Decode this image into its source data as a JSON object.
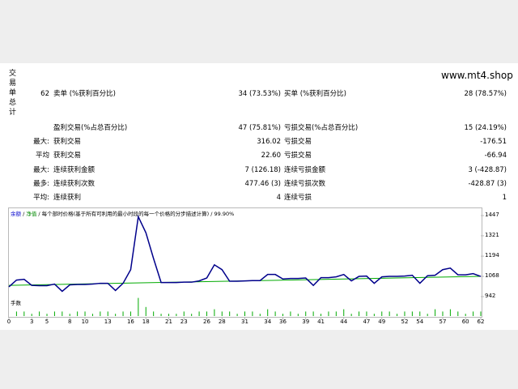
{
  "side_title": "交易单总计",
  "site": "www.mt4.shop",
  "stats": {
    "total_trades": "62",
    "short_label": "卖单 (%获利百分比)",
    "short_value": "34 (73.53%)",
    "long_label": "买单 (%获利百分比)",
    "long_value": "28 (78.57%)",
    "profit_trades_label": "盈利交易(%占总百分比)",
    "profit_trades_value": "47 (75.81%)",
    "loss_trades_label": "亏损交易(%占总百分比)",
    "loss_trades_value": "15 (24.19%)",
    "largest_label": "最大:",
    "largest_profit_label": "获利交易",
    "largest_profit_value": "316.02",
    "largest_loss_label": "亏损交易",
    "largest_loss_value": "-176.51",
    "average_label": "平均",
    "average_profit_label": "获利交易",
    "average_profit_value": "22.60",
    "average_loss_label": "亏损交易",
    "average_loss_value": "-66.94",
    "max_label": "最大:",
    "max_consec_wins_label": "连续获利金额",
    "max_consec_wins_value": "7 (126.18)",
    "max_consec_losses_label": "连续亏损金额",
    "max_consec_losses_value": "3 (-428.87)",
    "maximal_label": "最多:",
    "maximal_consec_profit_label": "连续获利次数",
    "maximal_consec_profit_value": "477.46 (3)",
    "maximal_consec_loss_label": "连续亏损次数",
    "maximal_consec_loss_value": "-428.87 (3)",
    "avg_label": "平均:",
    "avg_consec_wins_label": "连续获利",
    "avg_consec_wins_value": "4",
    "avg_consec_losses_label": "连续亏损",
    "avg_consec_losses_value": "1"
  },
  "chart": {
    "header_balance": "余额",
    "header_sep1": " / ",
    "header_equity": "净值",
    "header_rest": " / 每个部时价格(基于所有可利用的最小时段的每一个价格的分步描述计算) / 99.90%",
    "volume_label": "手数"
  },
  "chart_data": {
    "type": "line",
    "ylim": [
      942,
      1447
    ],
    "yticks": [
      "1447",
      "1321",
      "1194",
      "1068",
      "942"
    ],
    "xticks": [
      "0",
      "3",
      "5",
      "8",
      "10",
      "13",
      "16",
      "18",
      "21",
      "23",
      "26",
      "28",
      "31",
      "34",
      "36",
      "39",
      "41",
      "44",
      "47",
      "49",
      "52",
      "54",
      "57",
      "60",
      "62"
    ],
    "colors": {
      "balance": "#00008b",
      "equity": "#00aa00",
      "volume": "#00aa00",
      "axis": "#b9b9b9"
    },
    "series": [
      {
        "name": "余额",
        "x": [
          0,
          1,
          2,
          3,
          4,
          5,
          6,
          7,
          8,
          9,
          10,
          11,
          12,
          13,
          14,
          15,
          16,
          17,
          18,
          19,
          20,
          21,
          22,
          23,
          24,
          25,
          26,
          27,
          28,
          29,
          30,
          31,
          32,
          33,
          34,
          35,
          36,
          37,
          38,
          39,
          40,
          41,
          42,
          43,
          44,
          45,
          46,
          47,
          48,
          49,
          50,
          51,
          52,
          53,
          54,
          55,
          56,
          57,
          58,
          59,
          60,
          61,
          62
        ],
        "values": [
          1003,
          1045,
          1050,
          1012,
          1010,
          1010,
          1020,
          975,
          1015,
          1018,
          1018,
          1020,
          1025,
          1025,
          980,
          1025,
          1110,
          1440,
          1340,
          1180,
          1030,
          1030,
          1030,
          1032,
          1032,
          1040,
          1058,
          1140,
          1110,
          1038,
          1038,
          1040,
          1042,
          1042,
          1080,
          1080,
          1052,
          1055,
          1055,
          1058,
          1012,
          1060,
          1060,
          1065,
          1080,
          1040,
          1068,
          1070,
          1025,
          1065,
          1068,
          1068,
          1070,
          1075,
          1025,
          1072,
          1075,
          1110,
          1120,
          1078,
          1078,
          1085,
          1068
        ]
      }
    ],
    "equity_from": {
      "x": 0,
      "y": 1012
    },
    "equity_to": {
      "x": 62,
      "y": 1068
    },
    "volume": [
      0,
      2,
      2,
      1,
      2,
      1,
      2,
      2,
      1,
      2,
      2,
      1,
      2,
      2,
      1,
      2,
      2,
      8,
      4,
      2,
      1,
      1,
      1,
      2,
      1,
      2,
      2,
      3,
      2,
      2,
      1,
      2,
      2,
      1,
      3,
      2,
      1,
      2,
      1,
      2,
      2,
      1,
      2,
      2,
      3,
      1,
      2,
      2,
      1,
      2,
      2,
      1,
      2,
      2,
      2,
      1,
      3,
      2,
      3,
      2,
      1,
      2,
      2
    ]
  }
}
